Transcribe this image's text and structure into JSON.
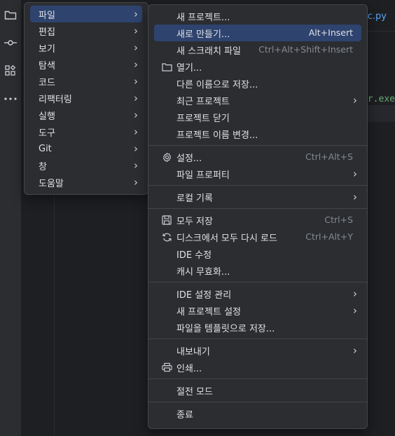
{
  "editor": {
    "tab_fragment": "c.py",
    "code_fragment": "r.exe"
  },
  "main_menu": [
    {
      "label": "파일",
      "selected": true
    },
    {
      "label": "편집"
    },
    {
      "label": "보기"
    },
    {
      "label": "탐색"
    },
    {
      "label": "코드"
    },
    {
      "label": "리팩터링"
    },
    {
      "label": "실행"
    },
    {
      "label": "도구"
    },
    {
      "label": "Git"
    },
    {
      "label": "창"
    },
    {
      "label": "도움말"
    }
  ],
  "file_menu": {
    "new_project": "새 프로젝트...",
    "new": {
      "label": "새로 만들기...",
      "shortcut": "Alt+Insert"
    },
    "new_scratch": {
      "label": "새 스크래치 파일",
      "shortcut": "Ctrl+Alt+Shift+Insert"
    },
    "open": "열기...",
    "save_as": "다른 이름으로 저장...",
    "recent_projects": "최근 프로젝트",
    "close_project": "프로젝트 닫기",
    "rename_project": "프로젝트 이름 변경...",
    "settings": {
      "label": "설정...",
      "shortcut": "Ctrl+Alt+S"
    },
    "file_properties": "파일 프로퍼티",
    "local_history": "로컬 기록",
    "save_all": {
      "label": "모두 저장",
      "shortcut": "Ctrl+S"
    },
    "reload_all": {
      "label": "디스크에서 모두 다시 로드",
      "shortcut": "Ctrl+Alt+Y"
    },
    "repair_ide": "IDE 수정",
    "invalidate_caches": "캐시 무효화...",
    "manage_ide_settings": "IDE 설정 관리",
    "new_project_settings": "새 프로젝트 설정",
    "save_as_template": "파일을 템플릿으로 저장...",
    "export": "내보내기",
    "print": "인쇄...",
    "power_save": "절전 모드",
    "exit": "종료"
  },
  "icons": {
    "submenu": "chevron-right-icon",
    "open": "folder-icon",
    "settings": "gear-icon",
    "save_all": "save-icon",
    "reload_all": "reload-icon",
    "print": "printer-icon"
  },
  "colors": {
    "selection": "#2e436e",
    "menu_bg": "#2b2d30",
    "shortcut_text": "#868a91"
  }
}
